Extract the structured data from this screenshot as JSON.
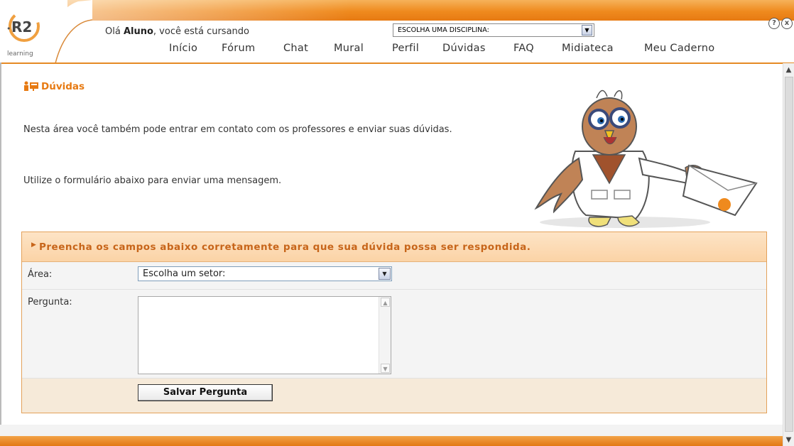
{
  "header": {
    "logo_text": "R2",
    "logo_sub": "learning",
    "greeting_prefix": "Olá",
    "greeting_user": "Aluno",
    "greeting_suffix": ", você está cursando",
    "discipline_select": "ESCOLHA UMA DISCIPLINA:",
    "help_icon": "?",
    "close_icon": "x"
  },
  "nav": {
    "items": [
      "Início",
      "Fórum",
      "Chat",
      "Mural",
      "Perfil",
      "Dúvidas",
      "FAQ",
      "Midiateca",
      "Meu Caderno"
    ]
  },
  "content": {
    "title": "Dúvidas",
    "paragraph1": "Nesta área você também pode entrar em contato com os professores e enviar suas dúvidas.",
    "paragraph2": "Utilize o formulário abaixo para enviar uma mensagem."
  },
  "form": {
    "header": "Preencha os campos abaixo corretamente para que sua dúvida possa ser respondida.",
    "area_label": "Área:",
    "area_value": "Escolha um setor:",
    "question_label": "Pergunta:",
    "question_value": "",
    "save_label": "Salvar Pergunta"
  },
  "colors": {
    "accent": "#e77a12",
    "form_header": "#fbd3a6",
    "form_text": "#c7651a"
  },
  "icons": [
    "help-icon",
    "close-icon",
    "doubts-icon",
    "chevron-down-icon",
    "owl-mascot-illustration"
  ]
}
